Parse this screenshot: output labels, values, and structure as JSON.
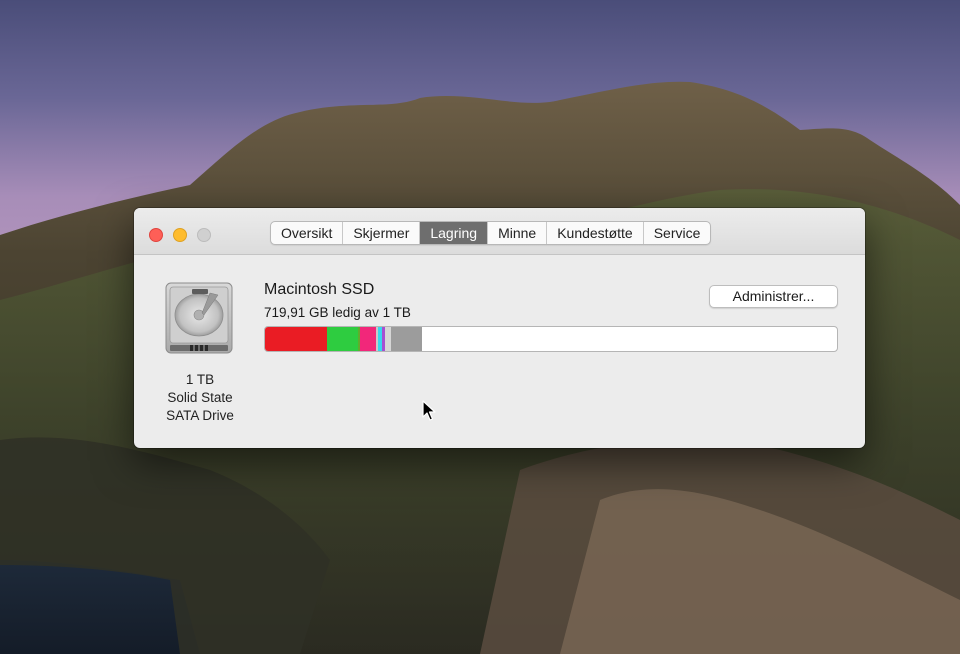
{
  "window": {
    "tabs": [
      {
        "label": "Oversikt",
        "active": false
      },
      {
        "label": "Skjermer",
        "active": false
      },
      {
        "label": "Lagring",
        "active": true
      },
      {
        "label": "Minne",
        "active": false
      },
      {
        "label": "Kundestøtte",
        "active": false
      },
      {
        "label": "Service",
        "active": false
      }
    ]
  },
  "drive": {
    "icon": "hard-drive-icon",
    "capacity": "1 TB",
    "type_line1": "Solid State",
    "type_line2": "SATA Drive"
  },
  "disk": {
    "name": "Macintosh SSD",
    "free_text": "719,91 GB ledig av 1 TB",
    "manage_button": "Administrer...",
    "usage_segments": [
      {
        "color": "#ea1c24",
        "fraction": 0.108
      },
      {
        "color": "#2ecc40",
        "fraction": 0.054
      },
      {
        "color": "#5fae2c",
        "fraction": 0.004
      },
      {
        "color": "#f2277a",
        "fraction": 0.028
      },
      {
        "color": "#c9c9c9",
        "fraction": 0.004
      },
      {
        "color": "#39d6ec",
        "fraction": 0.007
      },
      {
        "color": "#a54fd2",
        "fraction": 0.004
      },
      {
        "color": "#d6d6d6",
        "fraction": 0.012
      },
      {
        "color": "#9c9c9c",
        "fraction": 0.054
      }
    ]
  },
  "colors": {
    "active_tab": "#6e6e6e",
    "close": "#fe5f57",
    "minimize": "#febc2e"
  }
}
